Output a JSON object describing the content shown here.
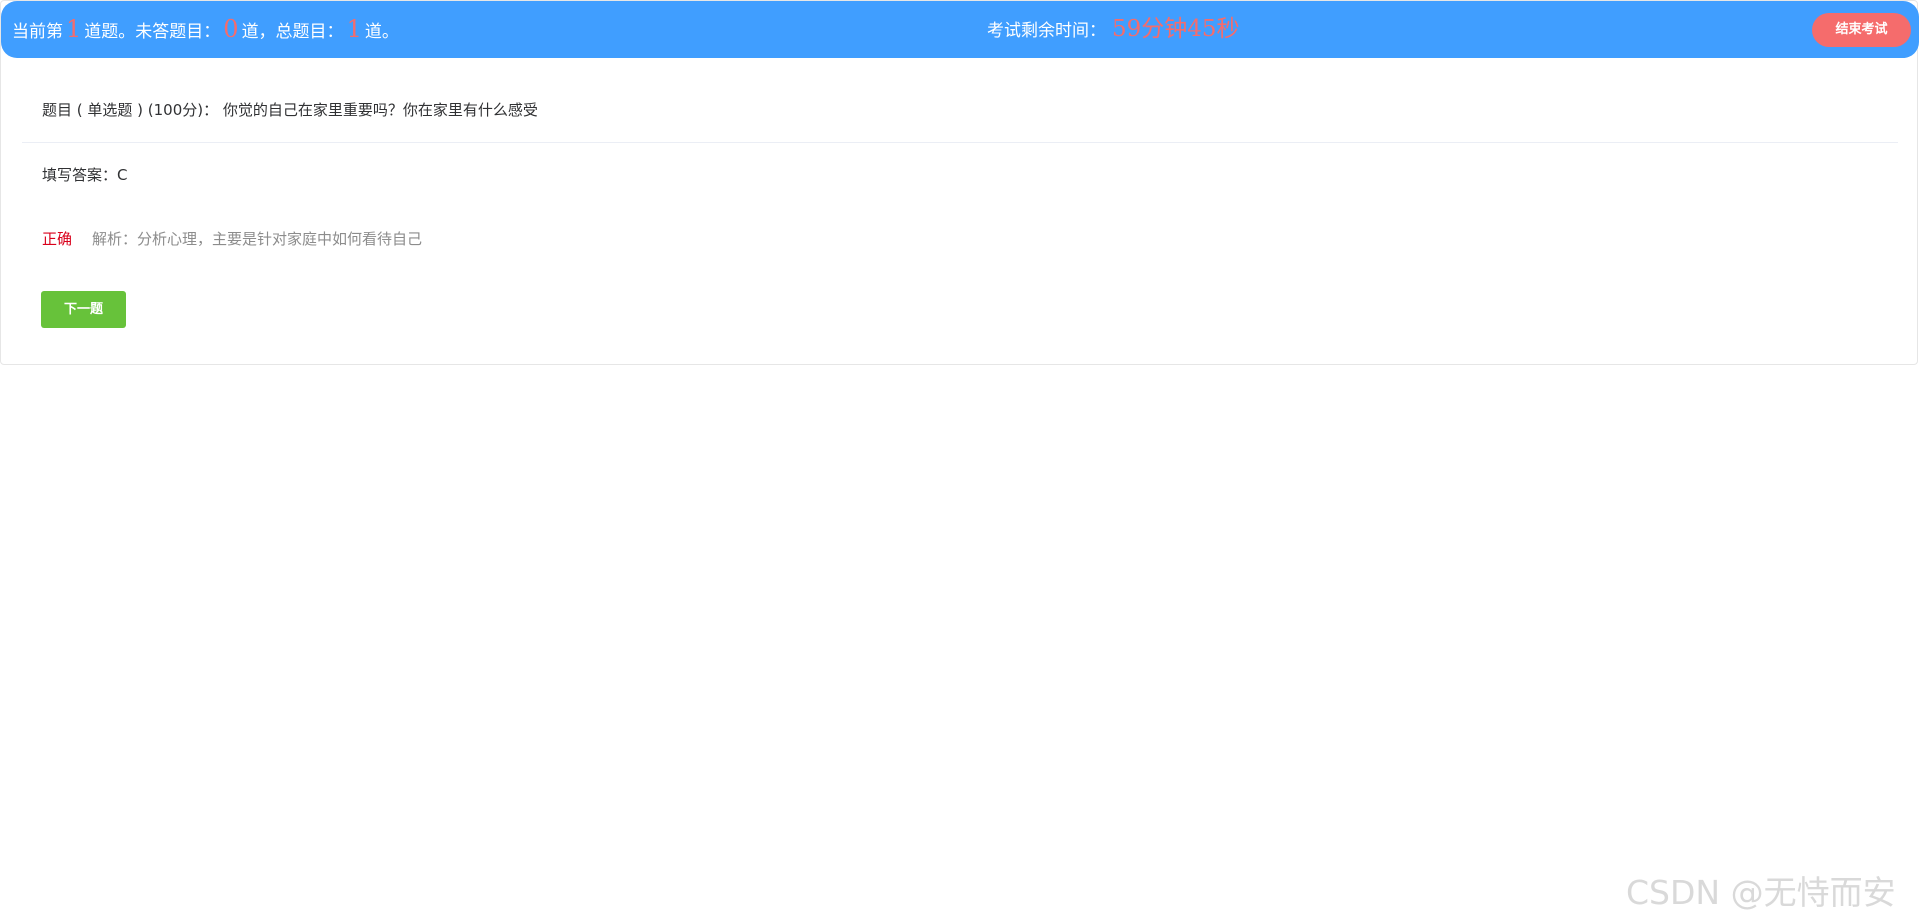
{
  "header": {
    "progress_prefix": "当前第",
    "current_num": "1",
    "progress_mid1": "道题。未答题目：",
    "unanswered_num": "0",
    "progress_mid2": "道，总题目：",
    "total_num": "1",
    "progress_suffix": "道。",
    "timer_label": "考试剩余时间：",
    "timer_value": "59分钟45秒",
    "end_button": "结束考试"
  },
  "question": {
    "text": "题目 ( 单选题 ) (100分)：  你觉的自己在家里重要吗？你在家里有什么感受"
  },
  "answer": {
    "text": "填写答案：C"
  },
  "result": {
    "status": "正确",
    "analysis": "解析：分析心理，主要是针对家庭中如何看待自己"
  },
  "actions": {
    "next_button": "下一题"
  },
  "watermark": "CSDN @无恃而安",
  "colors": {
    "header_bg": "#409eff",
    "accent_red": "#f56c6c",
    "correct_red": "#d9001b",
    "next_green": "#67c23a"
  }
}
